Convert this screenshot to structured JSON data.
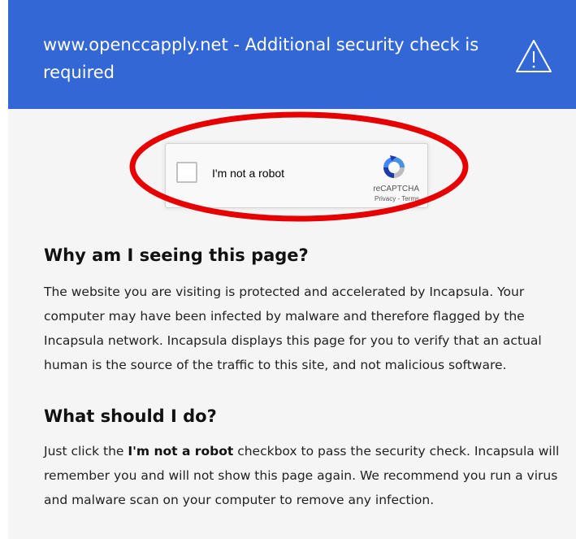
{
  "header": {
    "title": "www.openccapply.net - Additional security check is required",
    "icon": "warning-triangle-icon",
    "background": "#3367d6"
  },
  "captcha": {
    "checkbox_label": "I'm not a robot",
    "brand": "reCAPTCHA",
    "privacy_link": "Privacy",
    "separator": " - ",
    "terms_link": "Terms",
    "icon": "recaptcha-logo-icon",
    "highlight_color": "#e60000"
  },
  "why": {
    "heading": "Why am I seeing this page?",
    "body": "The website you are visiting is protected and accelerated by Incapsula. Your computer may have been infected by malware and therefore flagged by the Incapsula network. Incapsula displays this page for you to verify that an actual human is the source of the traffic to this site, and not malicious software."
  },
  "what": {
    "heading": "What should I do?",
    "body_prefix": "Just click the ",
    "body_bold": "I'm not a robot",
    "body_suffix": " checkbox to pass the security check. Incapsula will remember you and will not show this page again. We recommend you run a virus and malware scan on your computer to remove any infection."
  }
}
